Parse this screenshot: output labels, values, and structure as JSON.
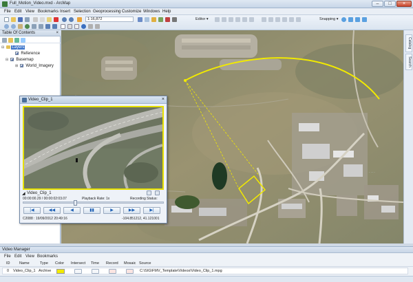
{
  "window": {
    "title": "Full_Motion_Video.mxd - ArcMap",
    "controls": [
      "–",
      "□",
      "×"
    ]
  },
  "menu": [
    "File",
    "Edit",
    "View",
    "Bookmarks",
    "Insert",
    "Selection",
    "Geoprocessing",
    "Customize",
    "Windows",
    "Help"
  ],
  "toolbar": {
    "scale": "1:16,872",
    "editor_label": "Editor ▾",
    "snapping_label": "Snapping ▾"
  },
  "toc": {
    "title": "Table Of Contents",
    "close": "×",
    "root_layer": "Layers",
    "items": [
      {
        "label": "Reference",
        "checked": true
      },
      {
        "label": "Basemap",
        "checked": true
      },
      {
        "label": "World_Imagery",
        "checked": true
      }
    ]
  },
  "right_dock": {
    "tabs": [
      "Catalog",
      "Search"
    ]
  },
  "video_window": {
    "title": "Video_Clip_1",
    "clip_name": "Video_Clip_1",
    "time": "00:00:00.29 / 00:00:02:03.07",
    "playback_rate": "Playback Rate: 1x",
    "recording_status": "Recording Status:",
    "sensor_info": "C2088 : 19/09/2012 20:49:16",
    "coordinates": "-104.851212, 41.121001",
    "position_fraction": 0.36,
    "controls": [
      "|◀",
      "◀◀",
      "◀",
      "▮▮",
      "▶",
      "▶▶",
      "▶|"
    ]
  },
  "video_manager": {
    "title": "Video Manager",
    "menu": [
      "File",
      "Edit",
      "View",
      "Bookmarks"
    ],
    "columns": [
      "ID",
      "Name",
      "Type",
      "Color",
      "Intersect",
      "Time",
      "Record",
      "Mosaic",
      "Source"
    ],
    "rows": [
      {
        "id": "0",
        "name": "Video_Clip_1",
        "type": "Archive",
        "color": "#f2ea00",
        "source": "C:\\SIG\\FMV_Template\\Videos\\Video_Clip_1.mpg"
      }
    ]
  },
  "colors": {
    "footprint": "#f2ea00",
    "chrome": "#dbe5f0"
  }
}
